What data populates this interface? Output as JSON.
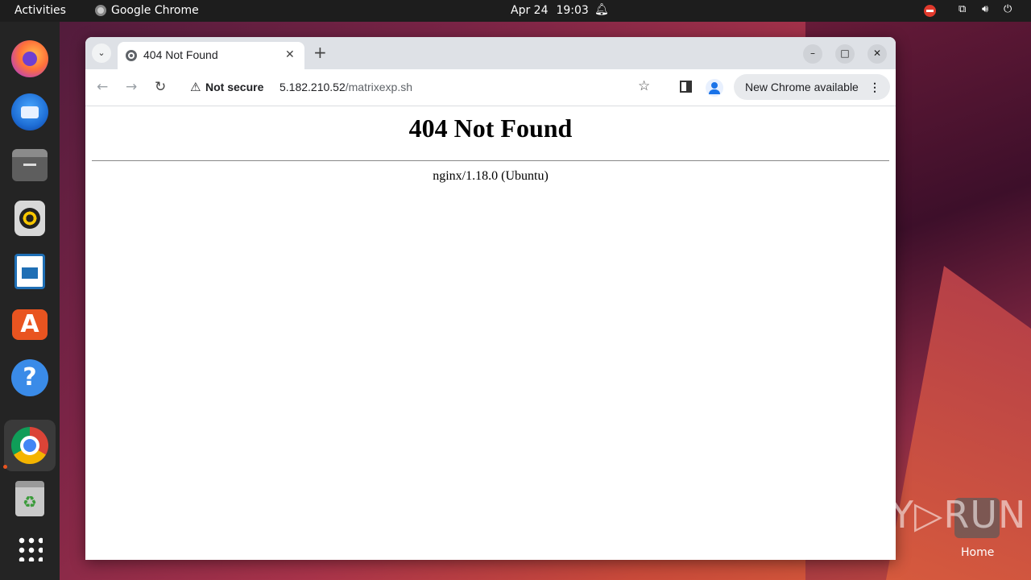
{
  "topbar": {
    "activities": "Activities",
    "app_name": "Google Chrome",
    "date": "Apr 24",
    "time": "19:03"
  },
  "dock": {
    "items": [
      "Firefox",
      "Thunderbird",
      "Files",
      "Rhythmbox",
      "LibreOffice Writer",
      "Ubuntu Software",
      "Help",
      "Google Chrome",
      "Trash",
      "Show Applications"
    ],
    "active": "Google Chrome"
  },
  "browser": {
    "tab_title": "404 Not Found",
    "new_tab_symbol": "+",
    "security_label": "Not secure",
    "url_host": "5.182.210.52",
    "url_path": "/matrixexp.sh",
    "update_label": "New Chrome available",
    "update_menu": "⋮"
  },
  "page": {
    "heading": "404 Not Found",
    "server": "nginx/1.18.0 (Ubuntu)"
  },
  "desktop": {
    "home_label": "Home",
    "watermark": "ANY▷RUN"
  },
  "colors": {
    "accent": "#e95420",
    "topbar_bg": "#1d1d1d",
    "dock_bg": "#242424",
    "tabstrip_bg": "#dee1e6"
  }
}
